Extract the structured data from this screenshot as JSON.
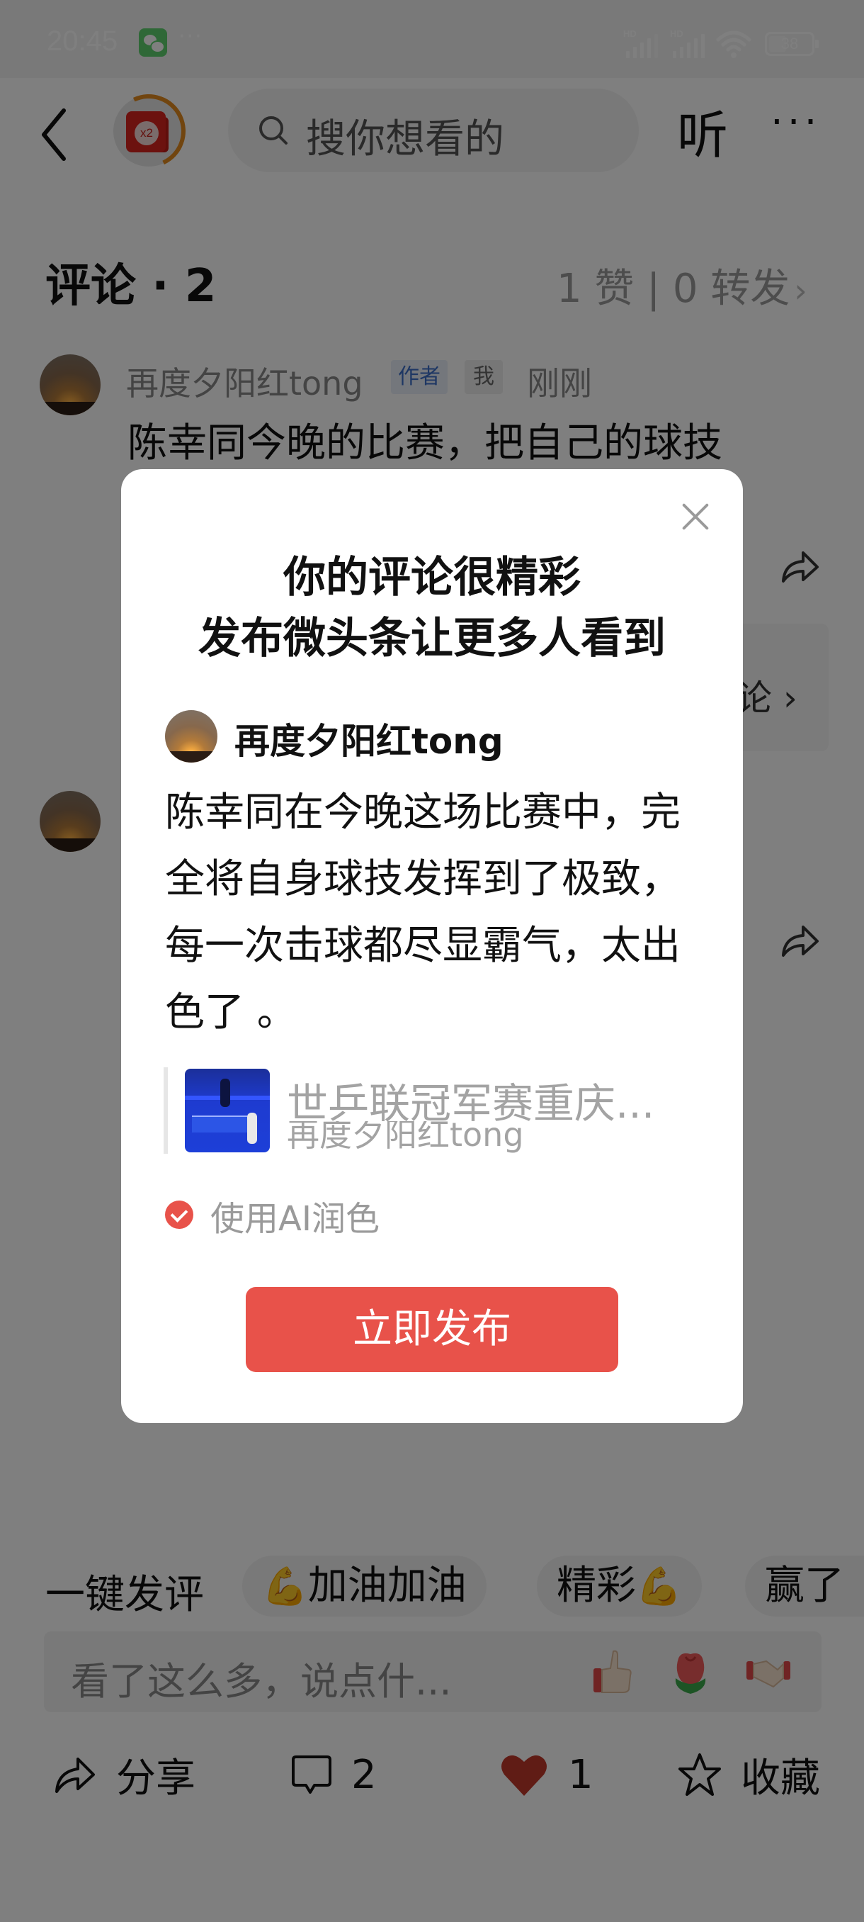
{
  "status_bar": {
    "time": "20:45",
    "notification_app_icon": "wechat-icon",
    "more_notifications": "···",
    "signal_1_label": "HD",
    "signal_2_label": "HD",
    "wifi_icon": "wifi-icon",
    "battery_percent": "38",
    "battery_level": 0.38
  },
  "top_nav": {
    "back_icon": "chevron-left-icon",
    "reward_badge_label": "x2",
    "search_placeholder": "搜你想看的",
    "listen_label": "听",
    "more_label": "···"
  },
  "comments_header": {
    "title": "评论 · 2",
    "stats": "1 赞 | 0 转发",
    "stats_chevron": "›"
  },
  "comments": [
    {
      "author": "再度夕阳红tong",
      "author_tag": "作者",
      "me_tag": "我",
      "time": "刚刚",
      "text": "陈幸同今晚的比赛，把自己的球技"
    },
    {
      "partial_reply_text": "论",
      "partial_reply_chevron": "›"
    }
  ],
  "quick_comment": {
    "label": "一键发评",
    "chips": [
      {
        "emoji_name": "flexed-biceps-icon",
        "emoji": "💪",
        "text": "加油加油",
        "emoji_position": "before"
      },
      {
        "emoji_name": "flexed-biceps-icon",
        "emoji": "💪",
        "text": "精彩",
        "emoji_position": "after"
      },
      {
        "text": "赢了"
      }
    ]
  },
  "comment_input": {
    "placeholder": "看了这么多，说点什...",
    "emoji_buttons": [
      "thumbs-up-icon",
      "rose-icon",
      "handshake-icon"
    ]
  },
  "action_bar": {
    "share_label": "分享",
    "comment_count": "2",
    "like_count": "1",
    "favorite_label": "收藏",
    "like_color": "#c0392b"
  },
  "nav_bar": {
    "items": [
      "menu-icon",
      "home-icon",
      "back-icon"
    ]
  },
  "modal": {
    "title_line1": "你的评论很精彩",
    "title_line2": "发布微头条让更多人看到",
    "author": "再度夕阳红tong",
    "text": "陈幸同在今晚这场比赛中，完全将自身球技发挥到了极致，每一次击球都尽显霸气，太出色了 。",
    "quote": {
      "title": "世乒联冠军赛重庆...",
      "author": "再度夕阳红tong"
    },
    "ai_polish_label": "使用AI润色",
    "ai_polish_checked": true,
    "publish_label": "立即发布",
    "accent_color": "#e8524a"
  }
}
